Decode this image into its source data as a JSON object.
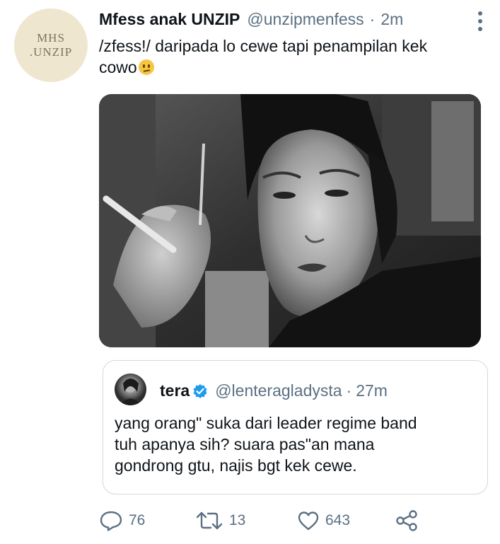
{
  "account": {
    "avatar_line1": "MHS",
    "avatar_line2": ".UNZIP",
    "display_name": "Mfess anak UNZIP",
    "handle": "@unzipmenfess",
    "separator": "·",
    "time": "2m"
  },
  "tweet": {
    "text_line1": "/zfess!/ daripada lo cewe tapi penampilan kek",
    "text_line2": "cowo",
    "emoji_icon": "confused-face-icon"
  },
  "quoted_tweet": {
    "display_name": "tera",
    "verified": true,
    "handle": "@lenteragladysta",
    "separator": "·",
    "time": "27m",
    "text_line1": "yang orang\" suka dari leader regime band",
    "text_line2": "tuh apanya sih? suara pas\"an mana",
    "text_line3": "gondrong gtu, najis bgt kek cewe."
  },
  "actions": {
    "reply_count": "76",
    "retweet_count": "13",
    "like_count": "643"
  },
  "colors": {
    "text": "#0f1419",
    "muted": "#5b7083",
    "verified": "#1d9bf0",
    "border": "#cfd9de",
    "avatar_bg": "#efe6cf"
  }
}
